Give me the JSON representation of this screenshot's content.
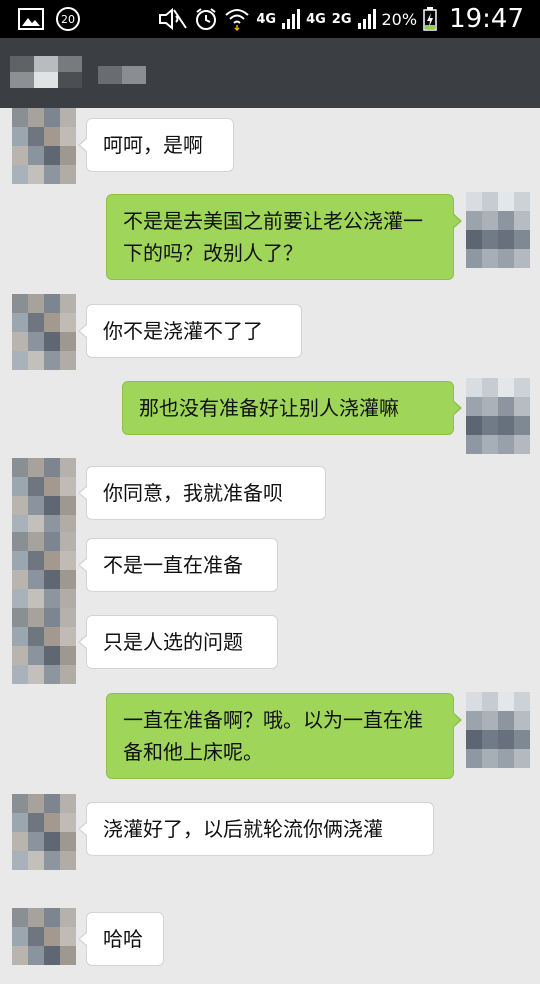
{
  "status_bar": {
    "notification_count": "20",
    "network_1": "4G",
    "network_2": "4G",
    "network_3": "2G",
    "battery": "20%",
    "time": "19:47",
    "icons": [
      "image-icon",
      "circle-badge-icon",
      "mute-icon",
      "alarm-icon",
      "wifi-icon",
      "signal-icon",
      "battery-charging-icon"
    ]
  },
  "header": {
    "contact_name": ""
  },
  "messages": [
    {
      "side": "left",
      "text": "呵呵，是啊"
    },
    {
      "side": "right",
      "text": "不是是去美国之前要让老公浇灌一下的吗？改别人了？"
    },
    {
      "side": "left",
      "text": "你不是浇灌不了了"
    },
    {
      "side": "right",
      "text": "那也没有准备好让别人浇灌嘛"
    },
    {
      "side": "left",
      "text": "你同意，我就准备呗"
    },
    {
      "side": "left",
      "text": "不是一直在准备"
    },
    {
      "side": "left",
      "text": "只是人选的问题"
    },
    {
      "side": "right",
      "text": "一直在准备啊？哦。以为一直在准备和他上床呢。"
    },
    {
      "side": "left",
      "text": "浇灌好了，以后就轮流你俩浇灌"
    },
    {
      "side": "left",
      "text": "哈哈"
    }
  ],
  "colors": {
    "background": "#e9e9e9",
    "header": "#3b3f43",
    "sent_bubble": "#9fd65a",
    "received_bubble": "#ffffff"
  }
}
